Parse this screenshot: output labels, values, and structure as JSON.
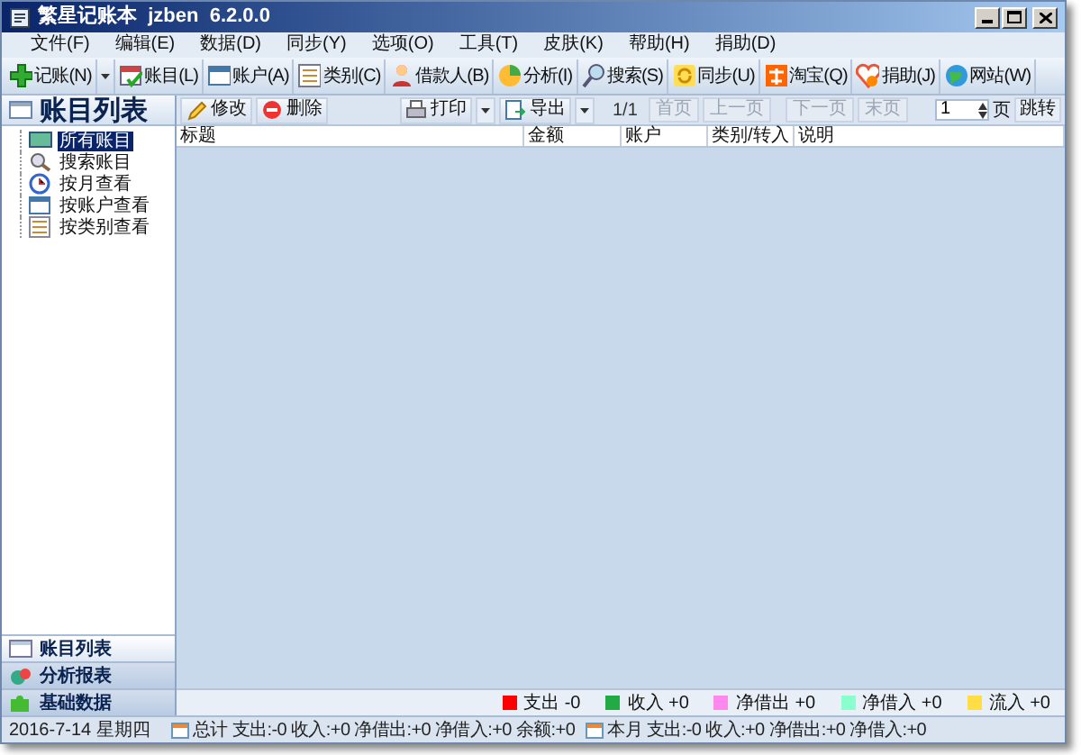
{
  "window": {
    "title": "繁星记账本  jzben  6.2.0.0"
  },
  "menu": [
    "文件(F)",
    "编辑(E)",
    "数据(D)",
    "同步(Y)",
    "选项(O)",
    "工具(T)",
    "皮肤(K)",
    "帮助(H)",
    "捐助(D)"
  ],
  "toolbar": [
    {
      "label": "记账(N)",
      "dropdown": true
    },
    {
      "label": "账目(L)",
      "dropdown": false
    },
    {
      "label": "账户(A)",
      "dropdown": false
    },
    {
      "label": "类别(C)",
      "dropdown": false
    },
    {
      "label": "借款人(B)",
      "dropdown": false
    },
    {
      "label": "分析(I)",
      "dropdown": false
    },
    {
      "label": "搜索(S)",
      "dropdown": false
    },
    {
      "label": "同步(U)",
      "dropdown": false
    },
    {
      "label": "淘宝(Q)",
      "dropdown": false
    },
    {
      "label": "捐助(J)",
      "dropdown": false
    },
    {
      "label": "网站(W)",
      "dropdown": false
    }
  ],
  "sidebar": {
    "title": "账目列表",
    "tree": [
      {
        "label": "所有账目",
        "selected": true
      },
      {
        "label": "搜索账目",
        "selected": false
      },
      {
        "label": "按月查看",
        "selected": false
      },
      {
        "label": "按账户查看",
        "selected": false
      },
      {
        "label": "按类别查看",
        "selected": false
      }
    ],
    "nav": [
      {
        "label": "账目列表",
        "selected": true
      },
      {
        "label": "分析报表",
        "selected": false
      },
      {
        "label": "基础数据",
        "selected": false
      }
    ]
  },
  "actions": [
    {
      "label": "修改",
      "dropdown": false
    },
    {
      "label": "删除",
      "dropdown": false
    },
    {
      "label": "打印",
      "dropdown": true
    },
    {
      "label": "导出",
      "dropdown": true
    }
  ],
  "pager": {
    "page_info": "1/1",
    "buttons": [
      {
        "label": "首页",
        "disabled": true
      },
      {
        "label": "上一页",
        "disabled": true
      },
      {
        "label": "下一页",
        "disabled": true
      },
      {
        "label": "末页",
        "disabled": true
      }
    ],
    "page_value": "1",
    "page_unit": "页",
    "jump": "跳转"
  },
  "table": {
    "columns": [
      "标题",
      "金额",
      "账户",
      "类别/转入",
      "说明"
    ]
  },
  "legend": [
    {
      "label": "支出",
      "value": "-0",
      "color": "#ff0000"
    },
    {
      "label": "收入",
      "value": "+0",
      "color": "#22aa44"
    },
    {
      "label": "净借出",
      "value": "+0",
      "color": "#ff88ee"
    },
    {
      "label": "净借入",
      "value": "+0",
      "color": "#88ffcc"
    },
    {
      "label": "流入",
      "value": "+0",
      "color": "#ffdd44"
    }
  ],
  "status_bar": {
    "date": "2016-7-14 星期四",
    "total": {
      "label": "总计",
      "text": "支出:-0 收入:+0 净借出:+0 净借入:+0 余额:+0"
    },
    "month": {
      "label": "本月",
      "text": "支出:-0 收入:+0 净借出:+0 净借入:+0"
    }
  }
}
